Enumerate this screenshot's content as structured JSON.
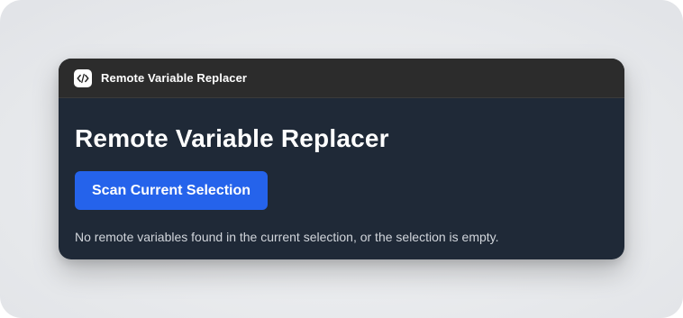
{
  "titlebar": {
    "icon": "code-brackets-icon",
    "title": "Remote Variable Replacer"
  },
  "main": {
    "heading": "Remote Variable Replacer",
    "scan_button_label": "Scan Current Selection",
    "status_message": "No remote variables found in the current selection, or the selection is empty."
  },
  "colors": {
    "window_background": "#1f2937",
    "titlebar_background": "#2c2c2c",
    "accent": "#2563eb",
    "muted_text": "#d1d5db"
  }
}
